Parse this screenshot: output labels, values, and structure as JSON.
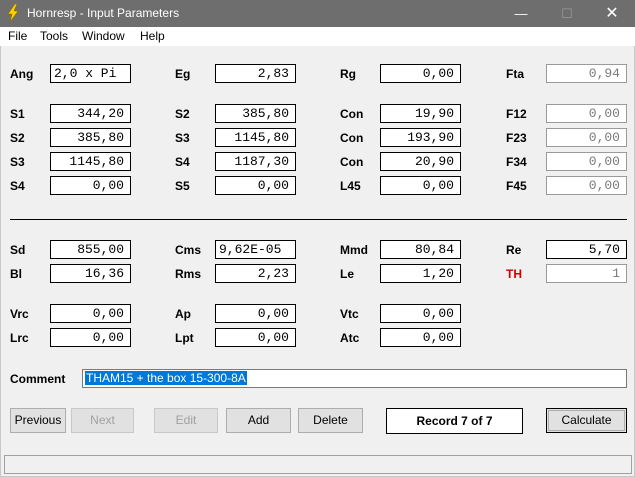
{
  "window": {
    "title": "Hornresp - Input Parameters",
    "min_glyph": "—",
    "max_glyph": "☐",
    "close_glyph": "✕"
  },
  "menu": [
    "File",
    "Tools",
    "Window",
    "Help"
  ],
  "rows": {
    "r1": [
      {
        "label": "Ang",
        "value": "2,0 x Pi"
      },
      {
        "label": "Eg",
        "value": "2,83"
      },
      {
        "label": "Rg",
        "value": "0,00"
      },
      {
        "label": "Fta",
        "value": "0,94"
      }
    ],
    "r2": [
      {
        "label": "S1",
        "value": "344,20"
      },
      {
        "label": "S2",
        "value": "385,80"
      },
      {
        "label": "Con",
        "value": "19,90"
      },
      {
        "label": "F12",
        "value": "0,00"
      }
    ],
    "r3": [
      {
        "label": "S2",
        "value": "385,80"
      },
      {
        "label": "S3",
        "value": "1145,80"
      },
      {
        "label": "Con",
        "value": "193,90"
      },
      {
        "label": "F23",
        "value": "0,00"
      }
    ],
    "r4": [
      {
        "label": "S3",
        "value": "1145,80"
      },
      {
        "label": "S4",
        "value": "1187,30"
      },
      {
        "label": "Con",
        "value": "20,90"
      },
      {
        "label": "F34",
        "value": "0,00"
      }
    ],
    "r5": [
      {
        "label": "S4",
        "value": "0,00"
      },
      {
        "label": "S5",
        "value": "0,00"
      },
      {
        "label": "L45",
        "value": "0,00"
      },
      {
        "label": "F45",
        "value": "0,00"
      }
    ],
    "r6": [
      {
        "label": "Sd",
        "value": "855,00"
      },
      {
        "label": "Cms",
        "value": "9,62E-05"
      },
      {
        "label": "Mmd",
        "value": "80,84"
      },
      {
        "label": "Re",
        "value": "5,70"
      }
    ],
    "r7": [
      {
        "label": "Bl",
        "value": "16,36"
      },
      {
        "label": "Rms",
        "value": "2,23"
      },
      {
        "label": "Le",
        "value": "1,20"
      },
      {
        "label": "TH",
        "value": "1"
      }
    ],
    "r8": [
      {
        "label": "Vrc",
        "value": "0,00"
      },
      {
        "label": "Ap",
        "value": "0,00"
      },
      {
        "label": "Vtc",
        "value": "0,00"
      }
    ],
    "r9": [
      {
        "label": "Lrc",
        "value": "0,00"
      },
      {
        "label": "Lpt",
        "value": "0,00"
      },
      {
        "label": "Atc",
        "value": "0,00"
      }
    ]
  },
  "comment": {
    "label": "Comment",
    "value": "THAM15 + the box 15-300-8A"
  },
  "buttons": {
    "previous": "Previous",
    "next": "Next",
    "edit": "Edit",
    "add": "Add",
    "delete": "Delete",
    "calculate": "Calculate"
  },
  "record": "Record 7 of 7",
  "colors": {
    "titlebar": "#6e6e6e",
    "selection": "#0078d7",
    "th_label": "#d00000"
  }
}
